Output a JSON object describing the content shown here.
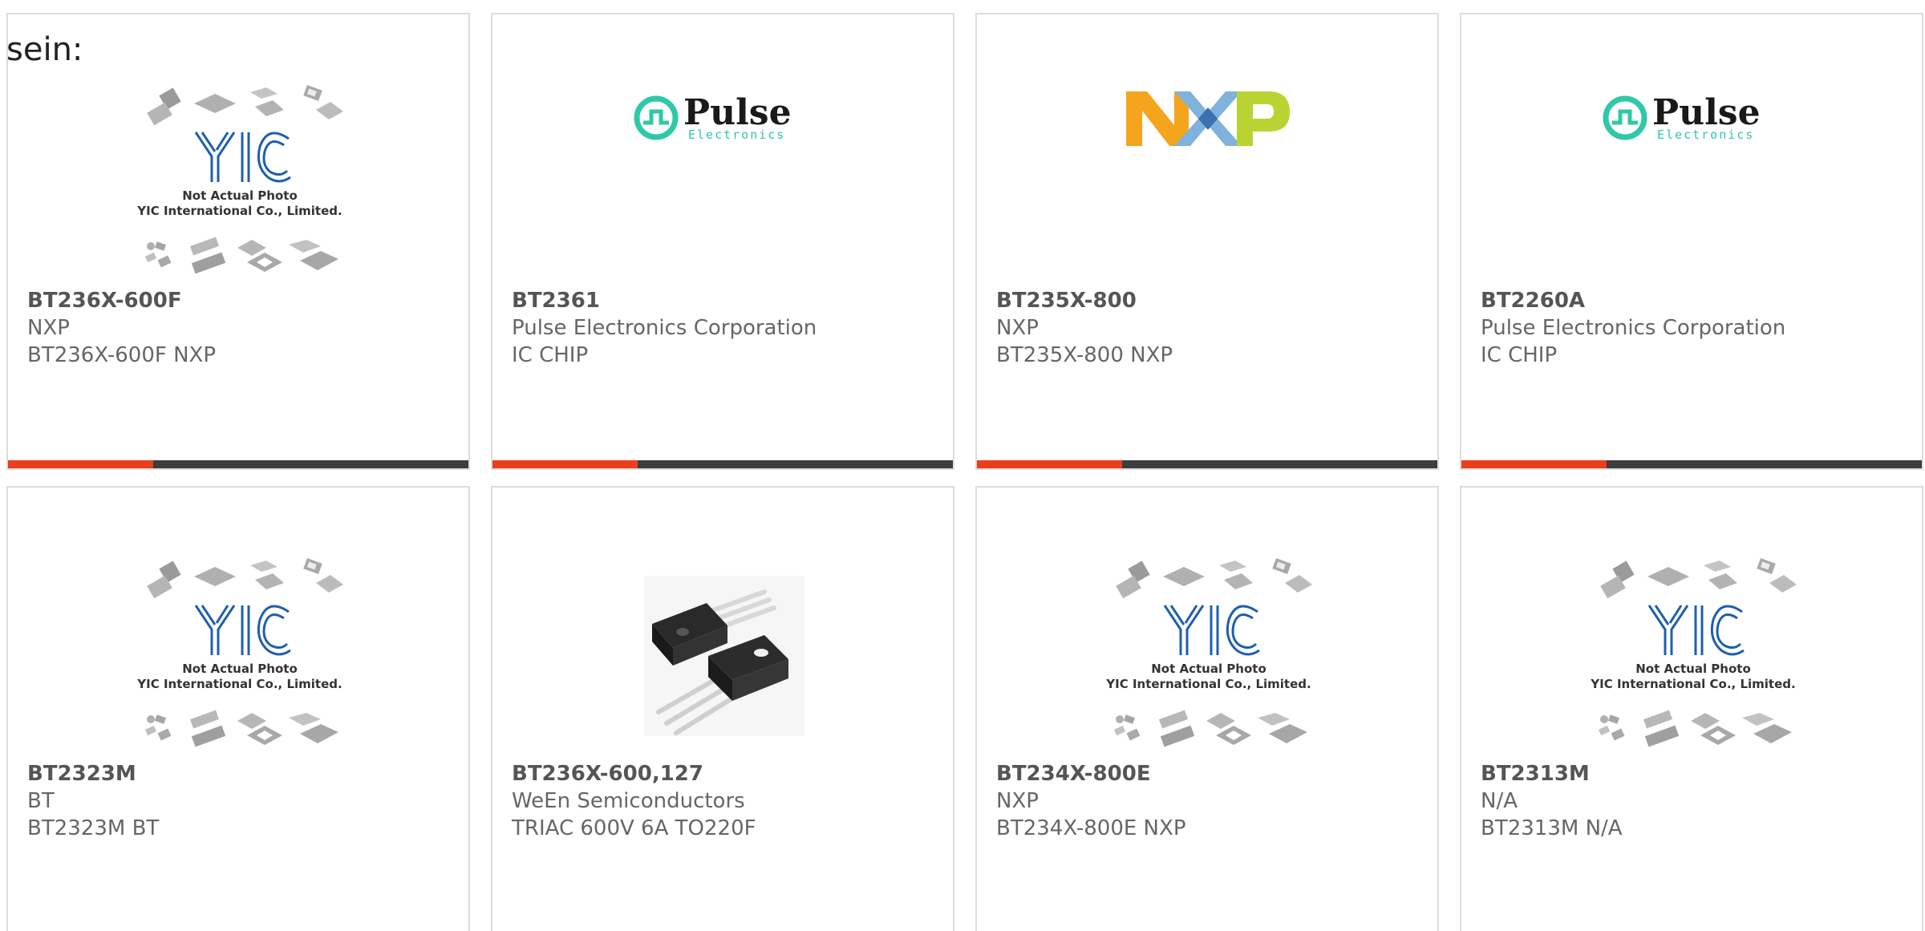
{
  "intro_text": "sein:",
  "colors": {
    "accent": "#e8401c",
    "track": "#3d3d3d",
    "pulse_teal": "#2fc8a8",
    "yic_blue": "#1f5fae"
  },
  "products": [
    {
      "part_number": "BT236X-600F",
      "manufacturer": "NXP",
      "description": "BT236X-600F NXP",
      "image_type": "yic",
      "image_caption_1": "Not Actual Photo",
      "image_caption_2": "YIC International Co., Limited.",
      "progress": 0.315
    },
    {
      "part_number": "BT2361",
      "manufacturer": "Pulse Electronics Corporation",
      "description": "IC CHIP",
      "image_type": "pulse",
      "logo_text": "Pulse",
      "logo_subtext": "Electronics",
      "progress": 0.315
    },
    {
      "part_number": "BT235X-800",
      "manufacturer": "NXP",
      "description": "BT235X-800 NXP",
      "image_type": "nxp",
      "progress": 0.315
    },
    {
      "part_number": "BT2260A",
      "manufacturer": "Pulse Electronics Corporation",
      "description": "IC CHIP",
      "image_type": "pulse",
      "logo_text": "Pulse",
      "logo_subtext": "Electronics",
      "progress": 0.315
    },
    {
      "part_number": "BT2323M",
      "manufacturer": "BT",
      "description": "BT2323M BT",
      "image_type": "yic",
      "image_caption_1": "Not Actual Photo",
      "image_caption_2": "YIC International Co., Limited.",
      "progress": 0
    },
    {
      "part_number": "BT236X-600,127",
      "manufacturer": "WeEn Semiconductors",
      "description": "TRIAC 600V 6A TO220F",
      "image_type": "triac",
      "progress": 0
    },
    {
      "part_number": "BT234X-800E",
      "manufacturer": "NXP",
      "description": "BT234X-800E NXP",
      "image_type": "yic",
      "image_caption_1": "Not Actual Photo",
      "image_caption_2": "YIC International Co., Limited.",
      "progress": 0
    },
    {
      "part_number": "BT2313M",
      "manufacturer": "N/A",
      "description": "BT2313M N/A",
      "image_type": "yic",
      "image_caption_1": "Not Actual Photo",
      "image_caption_2": "YIC International Co., Limited.",
      "progress": 0
    }
  ]
}
